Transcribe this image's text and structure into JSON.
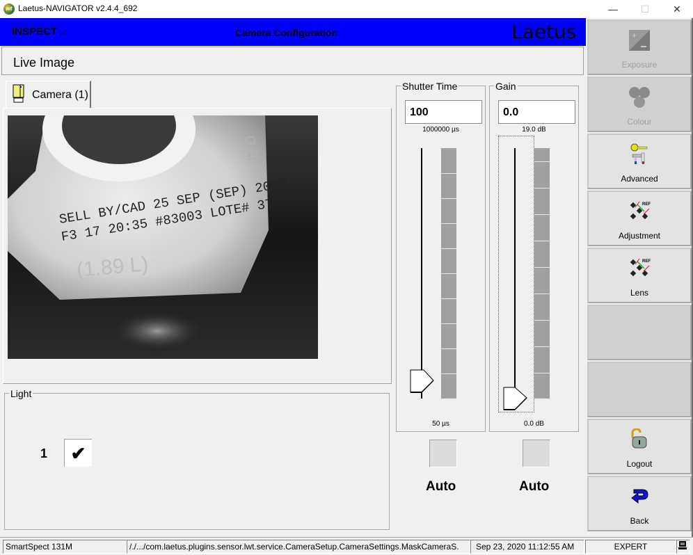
{
  "window": {
    "title": "Laetus-NAVIGATOR v2.4.4_692",
    "app_icon_text": "wt",
    "minimize": "—",
    "maximize": "☐",
    "close": "✕"
  },
  "header": {
    "mode": "INSPECT",
    "mode_suffix": "wt",
    "title": "Camera Configuration",
    "brand": "Laetus",
    "background_color": "#0000ff"
  },
  "page": {
    "title": "Live Image"
  },
  "camera": {
    "tab_label": "Camera (1)",
    "tab_icon": "camera-icon",
    "image_description": "Live grayscale camera image of a plastic jug with printed code 'SELL BY/CAD 25 SEP (SEP) 2020 F3 17 20:35 #83003 LOTE# 37' and embossed '(1.89 L)'"
  },
  "light": {
    "label": "Light",
    "channels": [
      {
        "number": "1",
        "checked": true,
        "mark": "✔"
      }
    ]
  },
  "shutter": {
    "label": "Shutter Time",
    "value": "100",
    "max_label": "1000000 µs",
    "min_label": "50 µs",
    "slider_fraction": 0.0,
    "auto_label": "Auto",
    "auto_checked": false
  },
  "gain": {
    "label": "Gain",
    "value": "0.0",
    "max_label": "19.0 dB",
    "min_label": "0.0 dB",
    "slider_fraction": 0.0,
    "auto_label": "Auto",
    "auto_checked": false
  },
  "sidebar": {
    "items": [
      {
        "label": "Exposure",
        "icon": "exposure-icon",
        "enabled": false
      },
      {
        "label": "Colour",
        "icon": "colour-icon",
        "enabled": false
      },
      {
        "label": "Advanced",
        "icon": "key-tools-icon",
        "enabled": true
      },
      {
        "label": "Adjustment",
        "icon": "ref-adjust-icon",
        "enabled": true
      },
      {
        "label": "Lens",
        "icon": "ref-lens-icon",
        "enabled": true
      },
      {
        "label": "",
        "icon": "",
        "enabled": false
      },
      {
        "label": "",
        "icon": "",
        "enabled": false
      },
      {
        "label": "Logout",
        "icon": "padlock-icon",
        "enabled": true
      },
      {
        "label": "Back",
        "icon": "back-arrow-icon",
        "enabled": true
      }
    ]
  },
  "status": {
    "device": "SmartSpect 131M",
    "path": "/./.../com.laetus.plugins.sensor.lwt.service.CameraSetup.CameraSettings.MaskCameraS.",
    "datetime": "Sep 23, 2020   11:12:55 AM",
    "user_level": "EXPERT",
    "terminal_icon": "computer-icon"
  }
}
